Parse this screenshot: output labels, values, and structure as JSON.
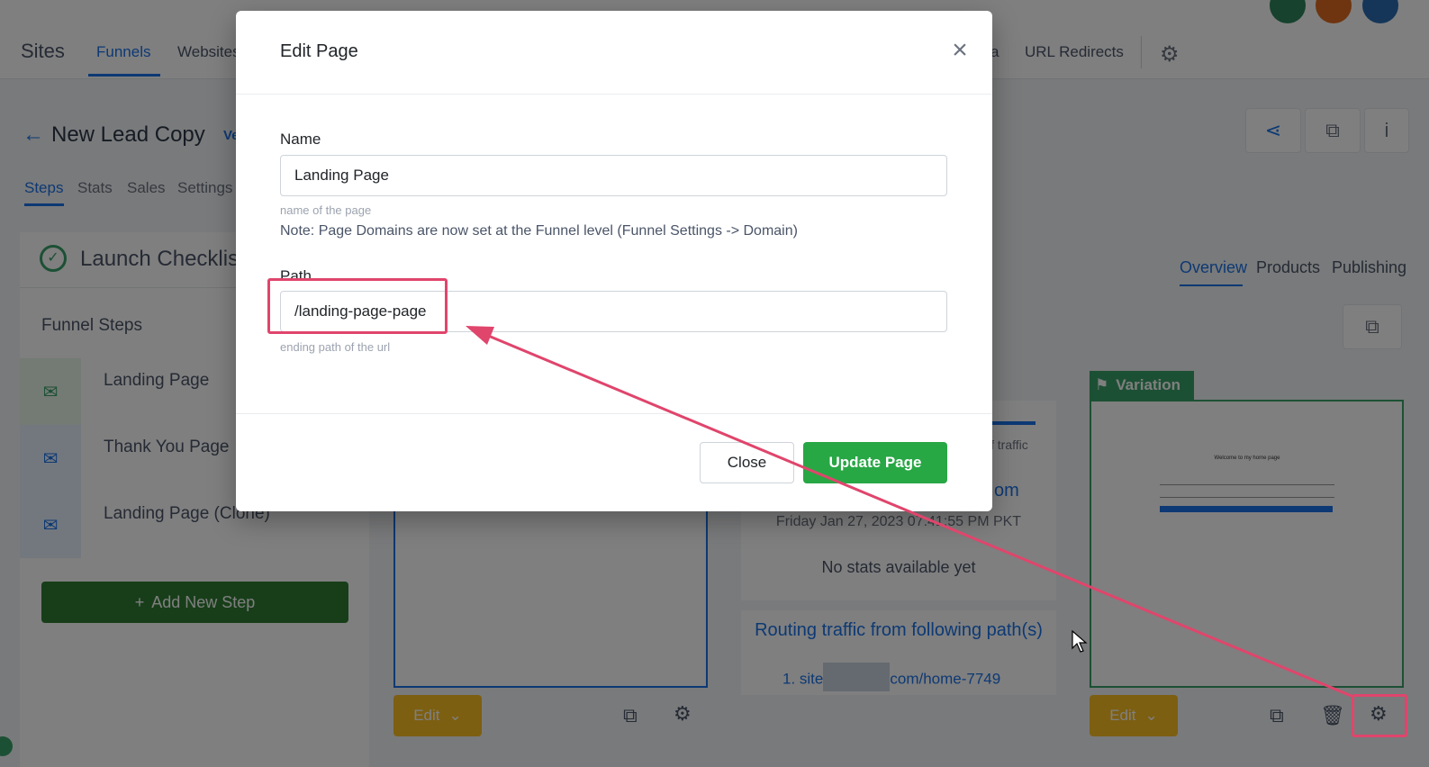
{
  "topbar": {
    "brand": "Sites",
    "nav": [
      "Funnels",
      "Websites",
      "a",
      "URL Redirects"
    ]
  },
  "funnel": {
    "title": "New Lead Copy",
    "badge": "Ve",
    "subnav": [
      "Steps",
      "Stats",
      "Sales",
      "Settings"
    ]
  },
  "sidebar": {
    "checklist": "Launch Checklist",
    "funnel_steps_label": "Funnel Steps",
    "steps": [
      {
        "label": "Landing Page"
      },
      {
        "label": "Thank You Page"
      },
      {
        "label": "Landing Page (Clone)"
      }
    ],
    "add_step": "Add New Step"
  },
  "main": {
    "tabs": [
      "Overview",
      "Products",
      "Publishing"
    ],
    "edit_label": "Edit",
    "traffic_label": "f traffic",
    "stats_link": "om",
    "stats_date": "Friday Jan 27, 2023 07:41:55 PM PKT",
    "stats_empty": "No stats available yet",
    "routing_title": "Routing traffic from following path(s)",
    "routing_item_prefix": "1. site",
    "routing_item_suffix": "com/home-7749",
    "variation_label": "Variation",
    "thumb_title": "Welcome to my home page"
  },
  "modal": {
    "title": "Edit Page",
    "name_label": "Name",
    "name_value": "Landing Page",
    "name_help": "name of the page",
    "note": "Note: Page Domains are now set at the Funnel level (Funnel Settings -> Domain)",
    "path_label": "Path",
    "path_value": "/landing-page-page",
    "path_help": "ending path of the url",
    "close_label": "Close",
    "update_label": "Update Page"
  },
  "colors": {
    "accent": "#1a73e8",
    "success": "#28a745",
    "annotation": "#e0456c",
    "warning": "#fbbf24"
  }
}
